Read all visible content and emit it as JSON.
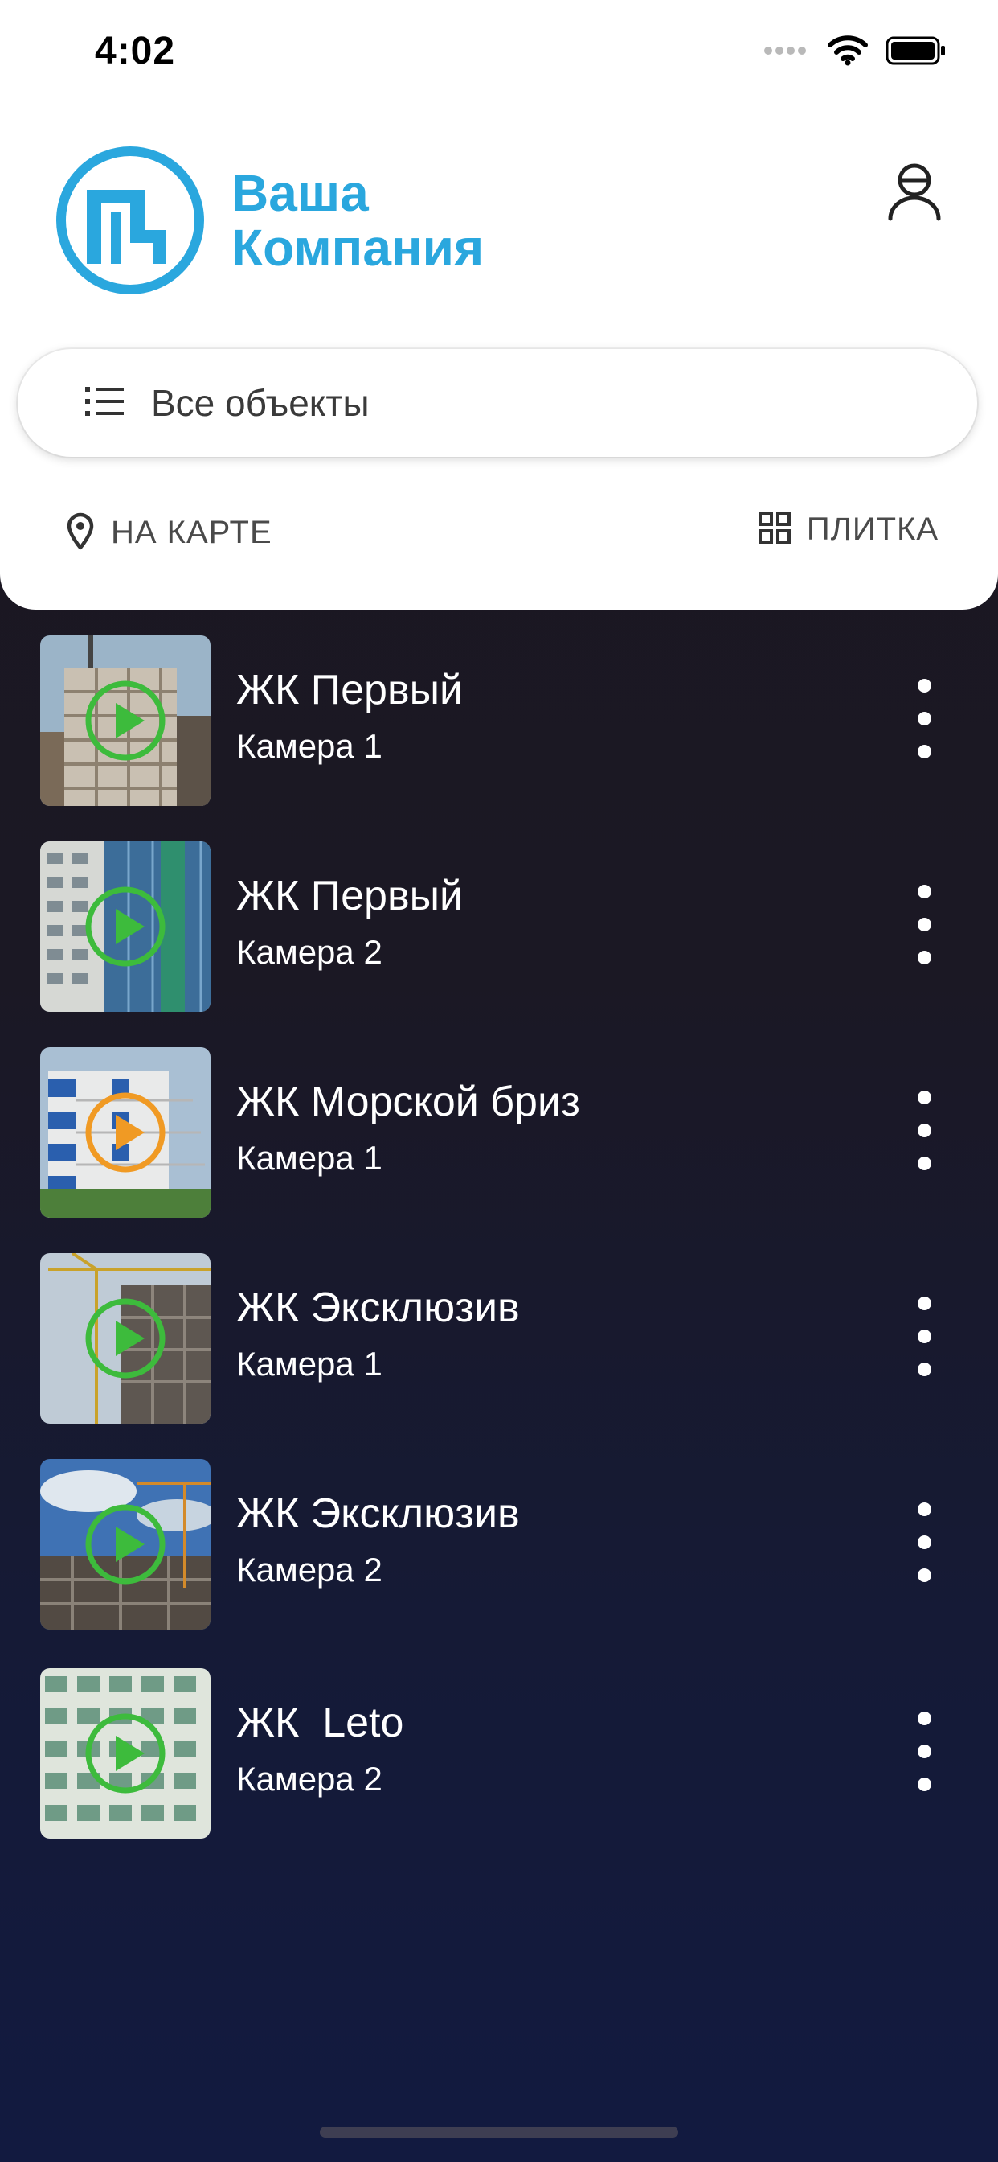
{
  "status_bar": {
    "time": "4:02",
    "icons": [
      "signal-dots-icon",
      "wifi-icon",
      "battery-icon"
    ]
  },
  "logo": {
    "line1": "Ваша",
    "line2": "Компания",
    "color": "#2aa7de"
  },
  "header": {
    "profile_icon": "user-icon",
    "filter_label": "Все объекты",
    "filter_icon": "list-icon",
    "map_label": "НА КАРТЕ",
    "map_icon": "location-pin-icon",
    "tile_label": "ПЛИТКА",
    "tile_icon": "grid-icon"
  },
  "colors": {
    "play_active": "#f09a24",
    "play_default": "#3dbb3c",
    "list_background": "#1b1824"
  },
  "cameras": [
    {
      "title": "ЖК Первый",
      "subtitle": "Камера 1",
      "play_state": "green"
    },
    {
      "title": "ЖК Первый",
      "subtitle": "Камера 2",
      "play_state": "green"
    },
    {
      "title": "ЖК Морской бриз",
      "subtitle": "Камера 1",
      "play_state": "orange"
    },
    {
      "title": "ЖК Эксклюзив",
      "subtitle": "Камера 1",
      "play_state": "green"
    },
    {
      "title": "ЖК Эксклюзив",
      "subtitle": "Камера 2",
      "play_state": "green"
    },
    {
      "title": "ЖК  Leto",
      "subtitle": "Камера 2",
      "play_state": "green"
    }
  ]
}
